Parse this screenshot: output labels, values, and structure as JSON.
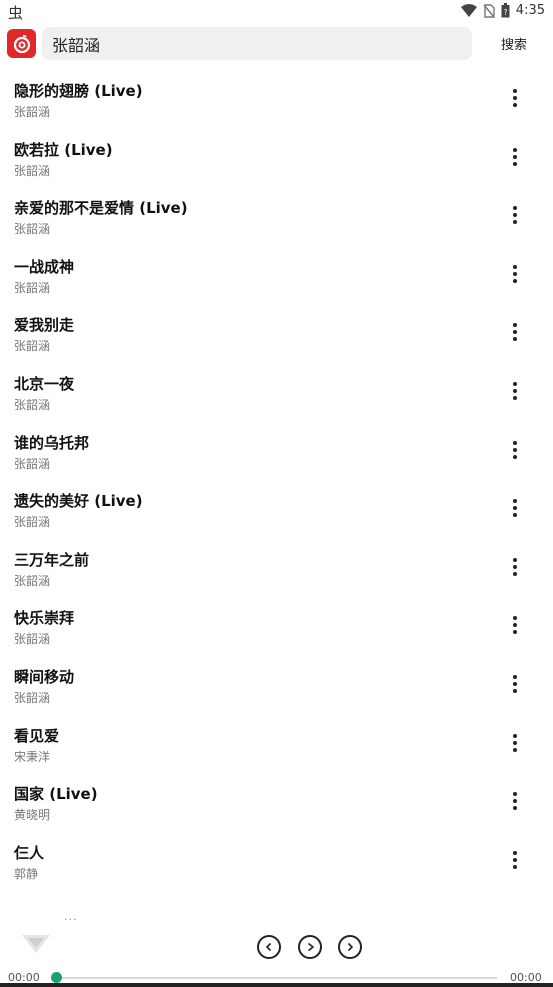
{
  "status_bar": {
    "left_glyph": "虫",
    "time": "4:35",
    "icons": [
      "wifi-icon",
      "no-sim-icon",
      "battery-icon"
    ]
  },
  "header": {
    "logo_icon": "netease-music-logo-icon",
    "search_value": "张韶涵",
    "search_placeholder": "",
    "search_label": "搜索"
  },
  "songs": [
    {
      "title": "隐形的翅膀 (Live)",
      "artist": "张韶涵"
    },
    {
      "title": "欧若拉 (Live)",
      "artist": "张韶涵"
    },
    {
      "title": "亲爱的那不是爱情 (Live)",
      "artist": "张韶涵"
    },
    {
      "title": "一战成神",
      "artist": "张韶涵"
    },
    {
      "title": "爱我别走",
      "artist": "张韶涵"
    },
    {
      "title": "北京一夜",
      "artist": "张韶涵"
    },
    {
      "title": "谁的乌托邦",
      "artist": "张韶涵"
    },
    {
      "title": "遗失的美好 (Live)",
      "artist": "张韶涵"
    },
    {
      "title": "三万年之前",
      "artist": "张韶涵"
    },
    {
      "title": "快乐崇拜",
      "artist": "张韶涵"
    },
    {
      "title": "瞬间移动",
      "artist": "张韶涵"
    },
    {
      "title": "看见爱",
      "artist": "宋秉洋"
    },
    {
      "title": "国家 (Live)",
      "artist": "黄晓明"
    },
    {
      "title": "仨人",
      "artist": "郭静"
    }
  ],
  "player": {
    "now_playing_dots": "...",
    "time_current": "00:00",
    "time_total": "00:00",
    "progress": 0,
    "accent_color": "#19a07a",
    "logo_color": "#e02a2a"
  }
}
